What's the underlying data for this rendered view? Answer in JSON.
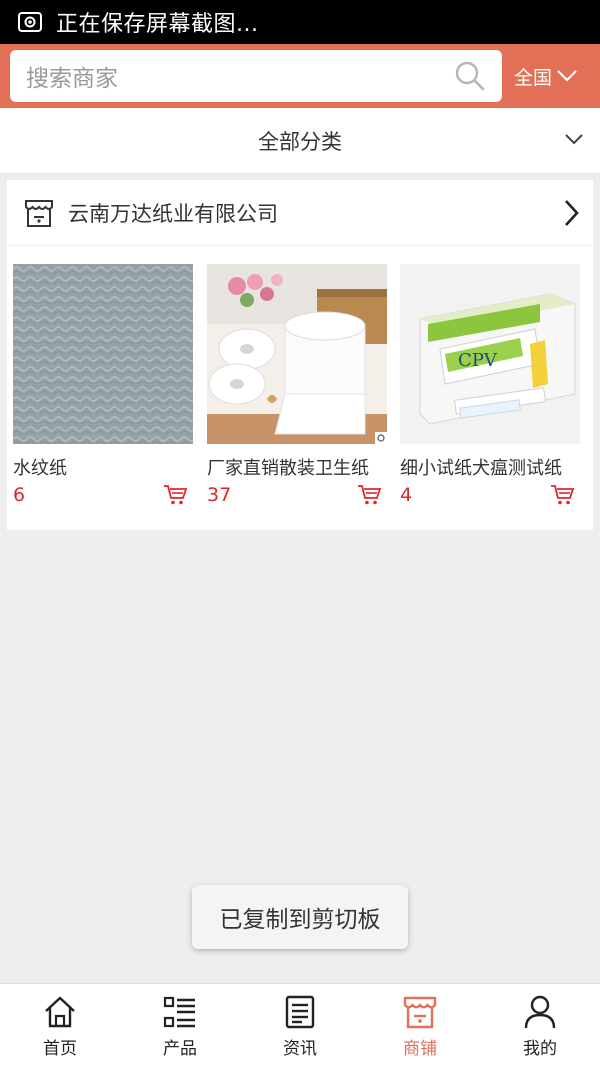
{
  "status_bar": {
    "text": "正在保存屏幕截图..."
  },
  "header": {
    "search_placeholder": "搜索商家",
    "region_label": "全国"
  },
  "category": {
    "label": "全部分类"
  },
  "shop": {
    "name": "云南万达纸业有限公司",
    "products": [
      {
        "name": "水纹纸",
        "price": "6"
      },
      {
        "name": "厂家直销散装卫生纸",
        "price": "37"
      },
      {
        "name": "细小试纸犬瘟测试纸",
        "price": "4"
      }
    ]
  },
  "toast": {
    "text": "已复制到剪切板"
  },
  "nav": {
    "items": [
      {
        "label": "首页",
        "icon": "home-icon"
      },
      {
        "label": "产品",
        "icon": "list-icon"
      },
      {
        "label": "资讯",
        "icon": "news-icon"
      },
      {
        "label": "商铺",
        "icon": "store-icon"
      },
      {
        "label": "我的",
        "icon": "user-icon"
      }
    ],
    "active_index": 3
  },
  "colors": {
    "accent": "#e27056",
    "price": "#e0262b",
    "background": "#eeeeee"
  }
}
